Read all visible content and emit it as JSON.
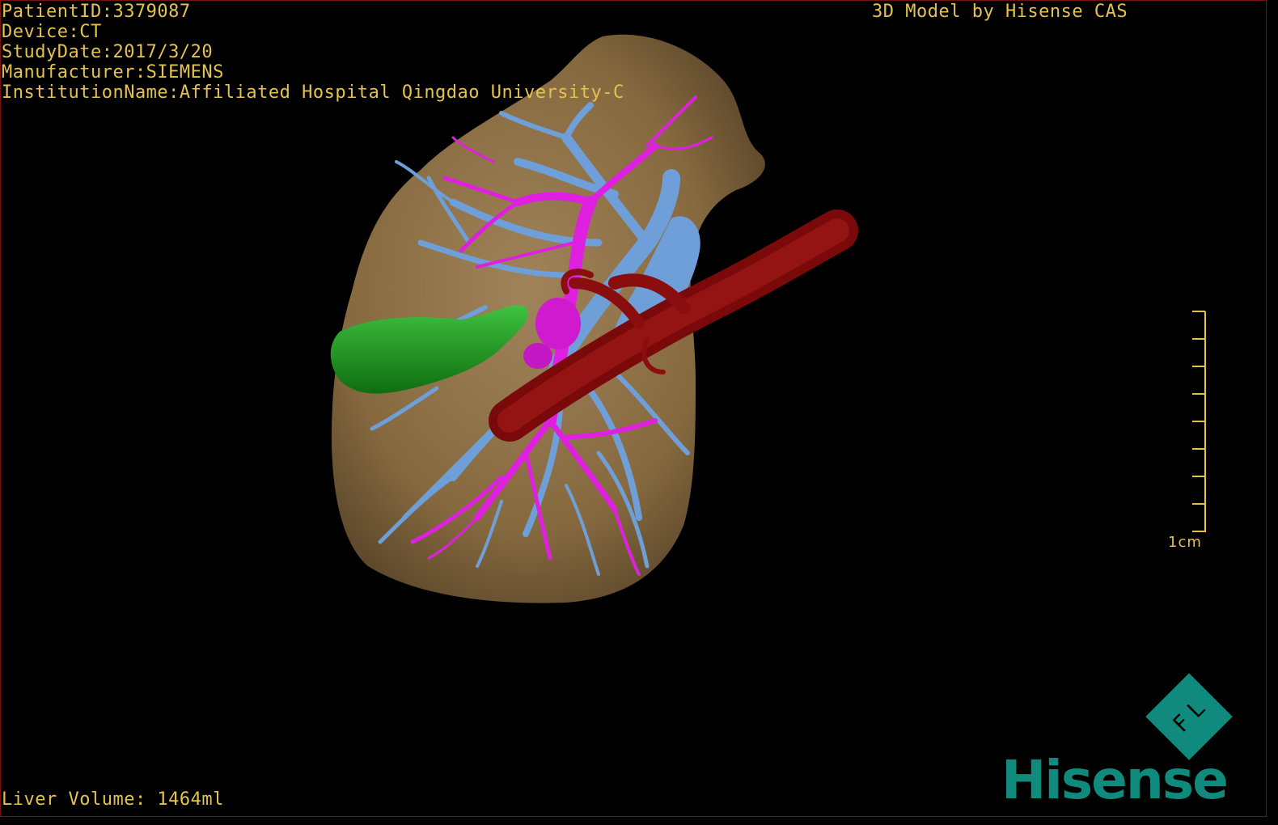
{
  "header": {
    "patient_id": "PatientID:3379087",
    "device": "Device:CT",
    "study_date": "StudyDate:2017/3/20",
    "manufacturer": "Manufacturer:SIEMENS",
    "institution": "InstitutionName:Affiliated Hospital Qingdao University-C"
  },
  "model_credit": "3D Model by Hisense CAS",
  "footer": {
    "liver_volume": "Liver Volume: 1464ml"
  },
  "scale_bar": {
    "label": "1cm"
  },
  "logo": {
    "wordmark": "Hisense",
    "badge_text": "F L"
  },
  "colors": {
    "overlay_text": "#e3c24f",
    "liver": "#8c7048",
    "portal_vein": "#6f9fd8",
    "hepatic_artery": "#e020e0",
    "vena_cava": "#7a0a0a",
    "gallbladder": "#1f9a1f",
    "brand": "#0f8a7c"
  }
}
